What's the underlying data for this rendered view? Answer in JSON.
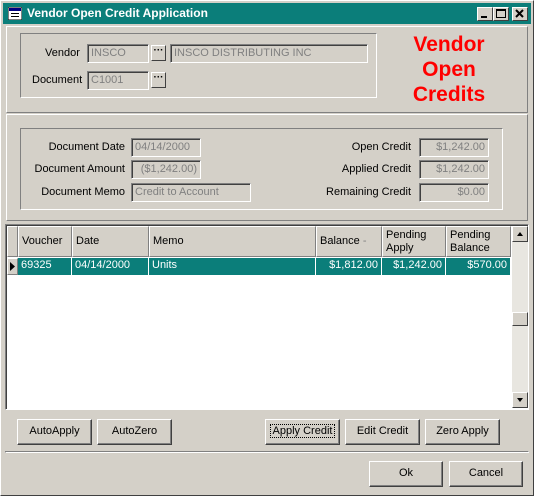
{
  "window": {
    "title": "Vendor Open Credit Application",
    "controls": [
      "_",
      "□",
      "✕"
    ]
  },
  "header": {
    "vendor_label": "Vendor",
    "vendor_code": "INSCO",
    "vendor_name": "INSCO DISTRIBUTING INC",
    "document_label": "Document",
    "document_value": "C1001",
    "lookup_glyph": "···",
    "headline_lines": [
      "Vendor",
      "Open",
      "Credits"
    ]
  },
  "details": {
    "document_date_label": "Document Date",
    "document_date": "04/14/2000",
    "document_amount_label": "Document Amount",
    "document_amount": "($1,242.00)",
    "document_memo_label": "Document Memo",
    "document_memo": "Credit to Account",
    "open_credit_label": "Open Credit",
    "open_credit": "$1,242.00",
    "applied_credit_label": "Applied Credit",
    "applied_credit": "$1,242.00",
    "remaining_credit_label": "Remaining Credit",
    "remaining_credit": "$0.00"
  },
  "grid": {
    "columns": [
      "Voucher",
      "Date",
      "Memo",
      "Balance",
      "Pending Apply",
      "Pending Balance"
    ],
    "column_lines": {
      "pending_apply": [
        "Pending",
        "Apply"
      ],
      "pending_balance": [
        "Pending",
        "Balance"
      ]
    },
    "sort_marker": "-",
    "rows": [
      {
        "voucher": "69325",
        "date": "04/14/2000",
        "memo": "Units",
        "balance": "$1,812.00",
        "pending_apply": "$1,242.00",
        "pending_balance": "$570.00",
        "selected": true
      }
    ]
  },
  "actions": {
    "auto_apply": "AutoApply",
    "auto_zero": "AutoZero",
    "apply_credit": "Apply Credit",
    "edit_credit": "Edit Credit",
    "zero_apply": "Zero Apply",
    "ok": "Ok",
    "cancel": "Cancel"
  },
  "colors": {
    "titlebar": "#0b7e7a",
    "selection": "#0b7e7a",
    "headline": "#ff0000",
    "face": "#d4d0c8"
  },
  "icons": [
    "app-icon",
    "minimize-icon",
    "maximize-icon",
    "close-icon",
    "ellipsis-icon",
    "row-pointer-icon",
    "scroll-up-icon",
    "scroll-down-icon"
  ]
}
